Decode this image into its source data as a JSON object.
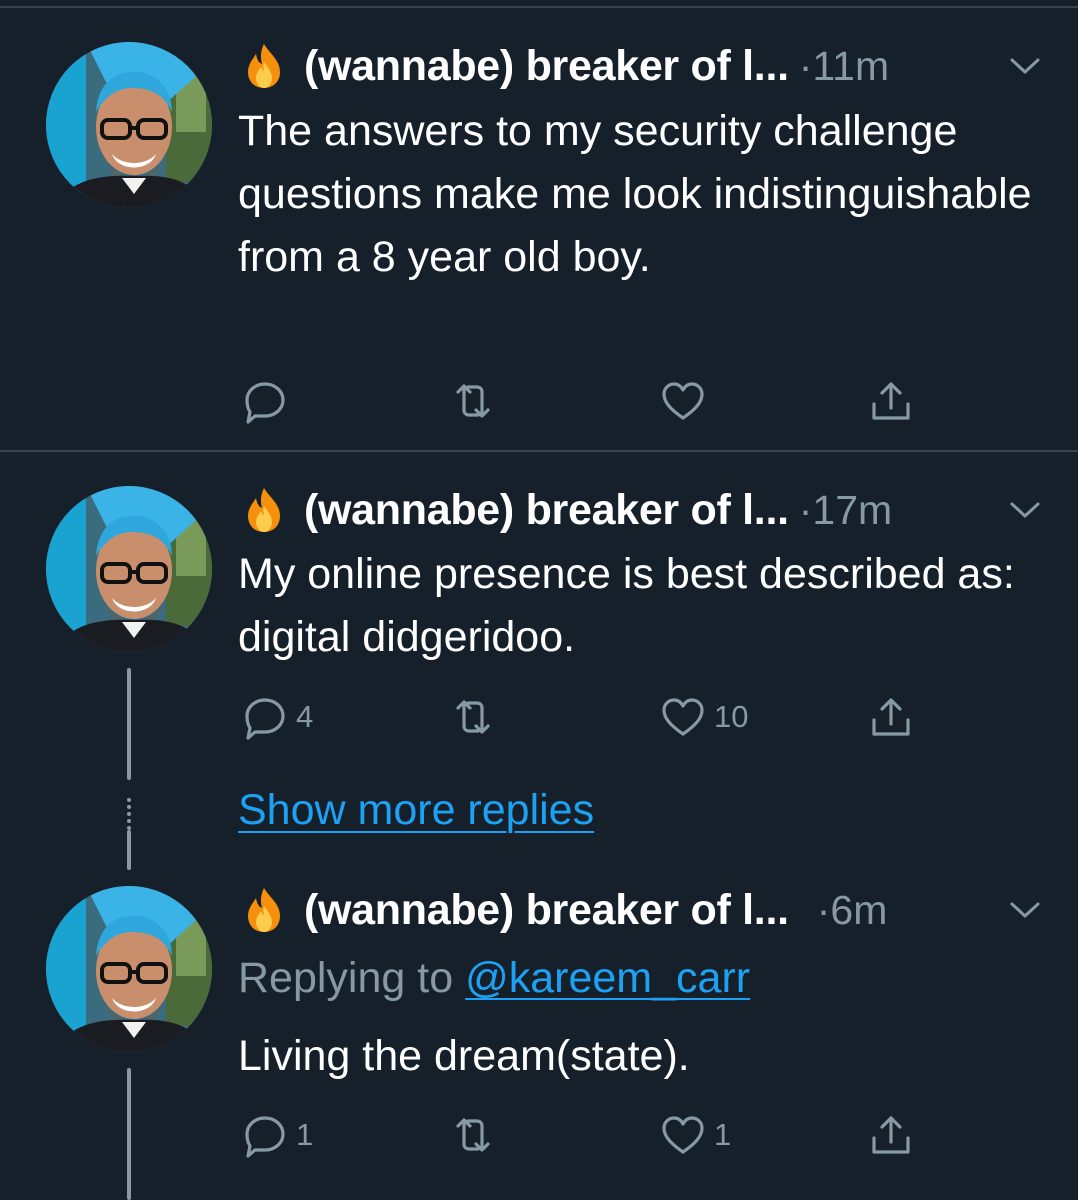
{
  "tweets": [
    {
      "author": "(wannabe) breaker of l...",
      "time_separator": "·",
      "time": "11m",
      "text": "The answers to my security challenge questions make me look indistinguishable from a 8 year old boy.",
      "reply_count": "",
      "retweet_count": "",
      "like_count": ""
    },
    {
      "author": "(wannabe) breaker of l...",
      "time_separator": "·",
      "time": "17m",
      "text": "My online presence is best described as: digital didgeridoo.",
      "reply_count": "4",
      "retweet_count": "",
      "like_count": "10"
    },
    {
      "author": "(wannabe) breaker of l...",
      "time_separator": "·",
      "time": "6m",
      "replying_prefix": "Replying to",
      "replying_to": "@kareem_carr",
      "text": "Living the dream(state).",
      "reply_count": "1",
      "retweet_count": "",
      "like_count": "1"
    }
  ],
  "show_more_replies": "Show more replies",
  "icons": {
    "author_emoji": "fire-icon",
    "menu": "chevron-down-icon",
    "reply": "reply-icon",
    "retweet": "retweet-icon",
    "like": "heart-icon",
    "share": "share-icon"
  },
  "colors": {
    "background": "#15202b",
    "divider": "#38444d",
    "primary_text": "#ffffff",
    "secondary_text": "#8899a6",
    "link": "#1da1f2"
  }
}
